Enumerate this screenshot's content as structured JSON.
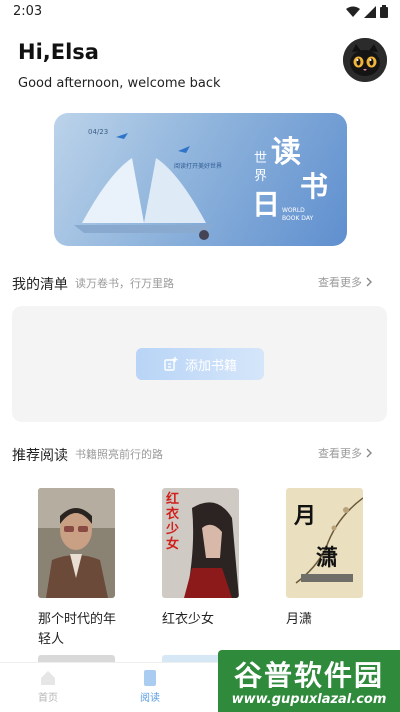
{
  "status_bar": {
    "time": "2:03"
  },
  "header": {
    "greeting": "Hi,Elsa",
    "subtitle": "Good afternoon, welcome back"
  },
  "banner": {
    "date": "04/23",
    "main_text": [
      "读",
      "书",
      "日"
    ],
    "side_text": [
      "世",
      "界"
    ],
    "english": "WORLD BOOK DAY",
    "tagline": "阅读打开美好世界"
  },
  "my_list": {
    "title": "我的清单",
    "subtitle": "读万卷书，行万里路",
    "more": "查看更多",
    "add_button": "添加书籍"
  },
  "recommend": {
    "title": "推荐阅读",
    "subtitle": "书籍照亮前行的路",
    "more": "查看更多",
    "books": [
      {
        "title": "那个时代的年轻人"
      },
      {
        "title": "红衣少女",
        "cover_text": "红衣少女"
      },
      {
        "title": "月潇",
        "cover_text": [
          "月",
          "潇"
        ]
      }
    ]
  },
  "tabbar": {
    "tabs": [
      {
        "label": "首页",
        "active": false
      },
      {
        "label": "阅读",
        "active": true
      }
    ]
  },
  "watermark": {
    "title": "谷普软件园",
    "url": "www.gupuxlazal.com"
  },
  "colors": {
    "accent": "#7ab1ec",
    "card_bg": "#f4f4f4",
    "watermark": "#2f8a3c"
  }
}
